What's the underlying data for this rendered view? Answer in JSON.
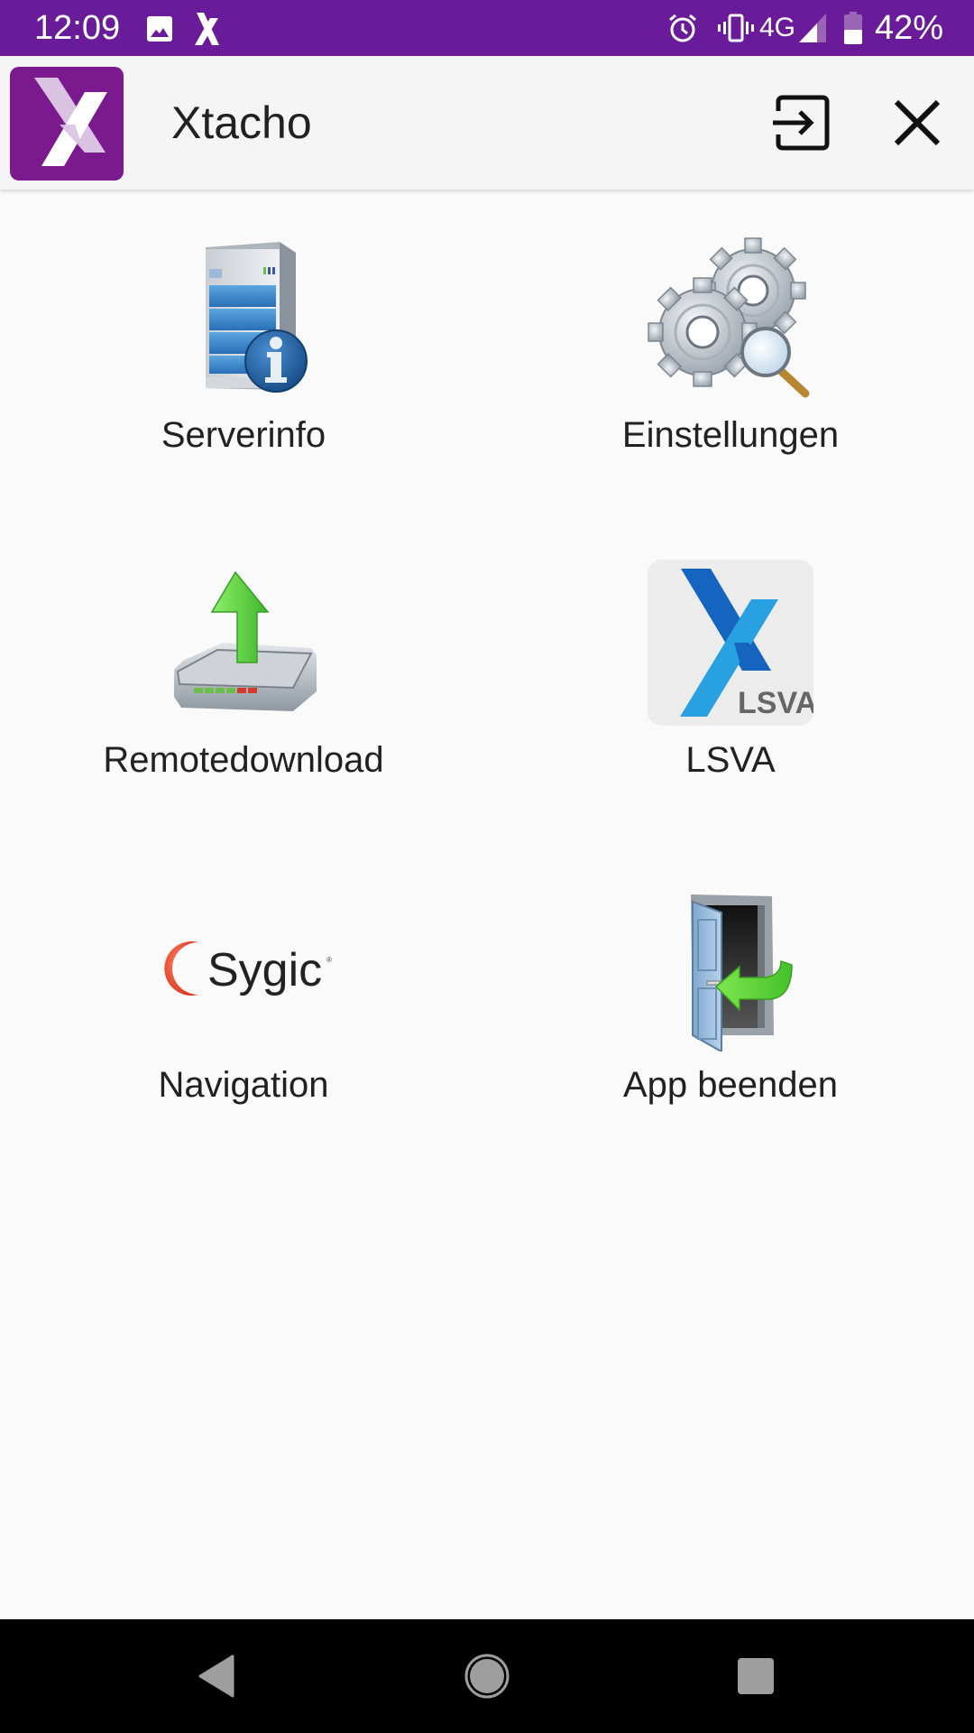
{
  "status_bar": {
    "time": "12:09",
    "left_icons": [
      "image-icon",
      "xtacho-notification-icon"
    ],
    "right_icons": [
      "alarm-icon",
      "vibrate-icon",
      "signal-icon",
      "battery-icon"
    ],
    "network": "4G",
    "battery": "42%",
    "battery_level": 0.42,
    "background_color": "#6a1b9a"
  },
  "app_bar": {
    "title": "Xtacho",
    "logo_color": "#7b1a8f",
    "actions": [
      {
        "name": "login",
        "icon": "login-icon"
      },
      {
        "name": "close",
        "icon": "close-icon"
      }
    ]
  },
  "menu": {
    "items": [
      {
        "label": "Serverinfo",
        "icon": "server-info-icon"
      },
      {
        "label": "Einstellungen",
        "icon": "settings-gears-icon"
      },
      {
        "label": "Remotedownload",
        "icon": "remote-download-icon"
      },
      {
        "label": "LSVA",
        "icon": "lsva-icon",
        "icon_text": "LSVA"
      },
      {
        "label": "Navigation",
        "icon": "sygic-icon",
        "icon_text": "Sygic"
      },
      {
        "label": "App beenden",
        "icon": "exit-door-icon"
      }
    ]
  },
  "nav_bar": {
    "buttons": [
      "back",
      "home",
      "recents"
    ]
  }
}
